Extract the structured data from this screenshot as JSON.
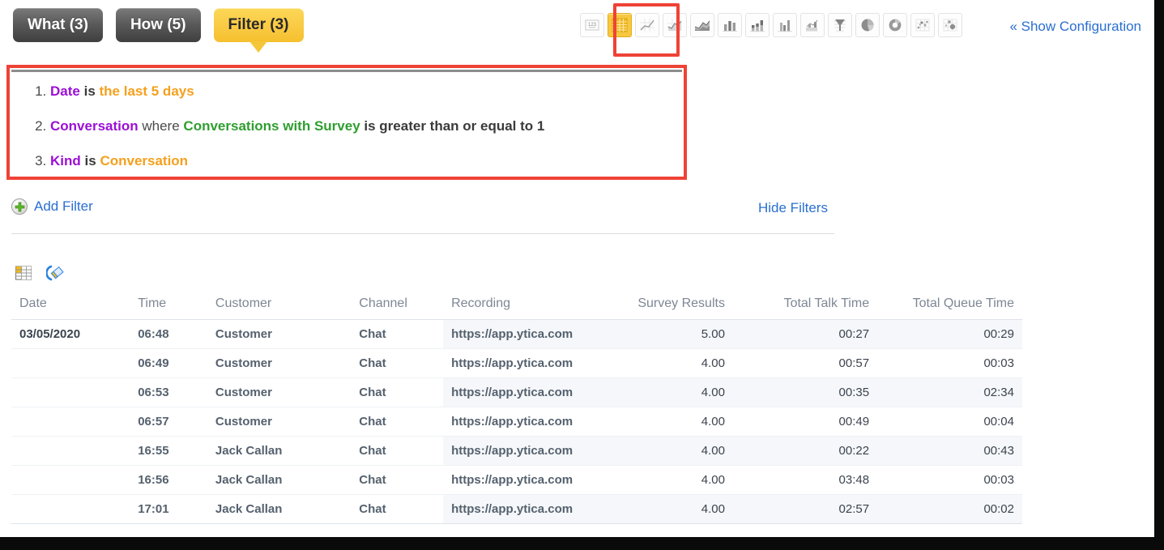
{
  "toolbar": {
    "tabs": [
      {
        "label": "What (3)",
        "active": false,
        "name": "tab-what"
      },
      {
        "label": "How (5)",
        "active": false,
        "name": "tab-how"
      },
      {
        "label": "Filter (3)",
        "active": true,
        "name": "tab-filter"
      }
    ],
    "show_configuration_label": "« Show Configuration",
    "viz_icons": [
      {
        "name": "headline-number-icon",
        "title": "Headline",
        "selected": false
      },
      {
        "name": "table-icon",
        "title": "Table",
        "selected": true
      },
      {
        "name": "line-chart-icon",
        "title": "Line Chart",
        "selected": false
      },
      {
        "name": "area-line-chart-icon",
        "title": "Area Line Chart",
        "selected": false
      },
      {
        "name": "stacked-area-chart-icon",
        "title": "Stacked Area Chart",
        "selected": false
      },
      {
        "name": "bar-chart-icon",
        "title": "Bar Chart",
        "selected": false
      },
      {
        "name": "stacked-bar-chart-icon",
        "title": "Stacked Bar Chart",
        "selected": false
      },
      {
        "name": "column-chart-icon",
        "title": "Column Chart",
        "selected": false
      },
      {
        "name": "combo-chart-icon",
        "title": "Combo Chart",
        "selected": false
      },
      {
        "name": "funnel-chart-icon",
        "title": "Funnel Chart",
        "selected": false
      },
      {
        "name": "pie-chart-icon",
        "title": "Pie Chart",
        "selected": false
      },
      {
        "name": "donut-chart-icon",
        "title": "Donut Chart",
        "selected": false
      },
      {
        "name": "scatter-plot-icon",
        "title": "Scatter Plot",
        "selected": false
      },
      {
        "name": "bubble-chart-icon",
        "title": "Bubble Chart",
        "selected": false
      }
    ],
    "highlight_color": "#ef4236"
  },
  "filters": {
    "items": [
      {
        "index": "1",
        "parts": [
          {
            "text": "Date",
            "kind": "attr"
          },
          {
            "text": "is",
            "kind": "plain"
          },
          {
            "text": "the last 5 days",
            "kind": "value"
          }
        ]
      },
      {
        "index": "2",
        "parts": [
          {
            "text": "Conversation",
            "kind": "attr"
          },
          {
            "text": "where",
            "kind": "word"
          },
          {
            "text": "Conversations with Survey",
            "kind": "metric"
          },
          {
            "text": "is greater than or equal to 1",
            "kind": "plain"
          }
        ]
      },
      {
        "index": "3",
        "parts": [
          {
            "text": "Kind",
            "kind": "attr"
          },
          {
            "text": "is",
            "kind": "plain"
          },
          {
            "text": "Conversation",
            "kind": "value"
          }
        ]
      }
    ],
    "add_filter_label": "Add Filter",
    "hide_filters_label": "Hide Filters",
    "colors": {
      "attribute": "#9b0fd6",
      "value": "#f5a01e",
      "metric": "#2f9e2f",
      "link": "#2a6fd1"
    }
  },
  "table_tools": [
    {
      "name": "table-settings-icon",
      "title": "Table Settings"
    },
    {
      "name": "clear-formatting-icon",
      "title": "Clear Formatting"
    }
  ],
  "chart_data": {
    "type": "table",
    "title": "",
    "columns": [
      {
        "header": "Date",
        "align": "left",
        "key": "date"
      },
      {
        "header": "Time",
        "align": "left",
        "key": "time"
      },
      {
        "header": "Customer",
        "align": "left",
        "key": "customer"
      },
      {
        "header": "Channel",
        "align": "left",
        "key": "channel"
      },
      {
        "header": "Recording",
        "align": "left",
        "key": "recording"
      },
      {
        "header": "Survey Results",
        "align": "right",
        "key": "survey_results"
      },
      {
        "header": "Total Talk Time",
        "align": "right",
        "key": "total_talk_time"
      },
      {
        "header": "Total Queue Time",
        "align": "right",
        "key": "total_queue_time"
      }
    ],
    "rows": [
      {
        "date": "03/05/2020",
        "time": "06:48",
        "customer": "Customer",
        "channel": "Chat",
        "recording": "https://app.ytica.com",
        "survey_results": "5.00",
        "total_talk_time": "00:27",
        "total_queue_time": "00:29"
      },
      {
        "date": "",
        "time": "06:49",
        "customer": "Customer",
        "channel": "Chat",
        "recording": "https://app.ytica.com",
        "survey_results": "4.00",
        "total_talk_time": "00:57",
        "total_queue_time": "00:03"
      },
      {
        "date": "",
        "time": "06:53",
        "customer": "Customer",
        "channel": "Chat",
        "recording": "https://app.ytica.com",
        "survey_results": "4.00",
        "total_talk_time": "00:35",
        "total_queue_time": "02:34"
      },
      {
        "date": "",
        "time": "06:57",
        "customer": "Customer",
        "channel": "Chat",
        "recording": "https://app.ytica.com",
        "survey_results": "4.00",
        "total_talk_time": "00:49",
        "total_queue_time": "00:04"
      },
      {
        "date": "",
        "time": "16:55",
        "customer": "Jack Callan",
        "channel": "Chat",
        "recording": "https://app.ytica.com",
        "survey_results": "4.00",
        "total_talk_time": "00:22",
        "total_queue_time": "00:43"
      },
      {
        "date": "",
        "time": "16:56",
        "customer": "Jack Callan",
        "channel": "Chat",
        "recording": "https://app.ytica.com",
        "survey_results": "4.00",
        "total_talk_time": "03:48",
        "total_queue_time": "00:03"
      },
      {
        "date": "",
        "time": "17:01",
        "customer": "Jack Callan",
        "channel": "Chat",
        "recording": "https://app.ytica.com",
        "survey_results": "4.00",
        "total_talk_time": "02:57",
        "total_queue_time": "00:02"
      }
    ]
  }
}
